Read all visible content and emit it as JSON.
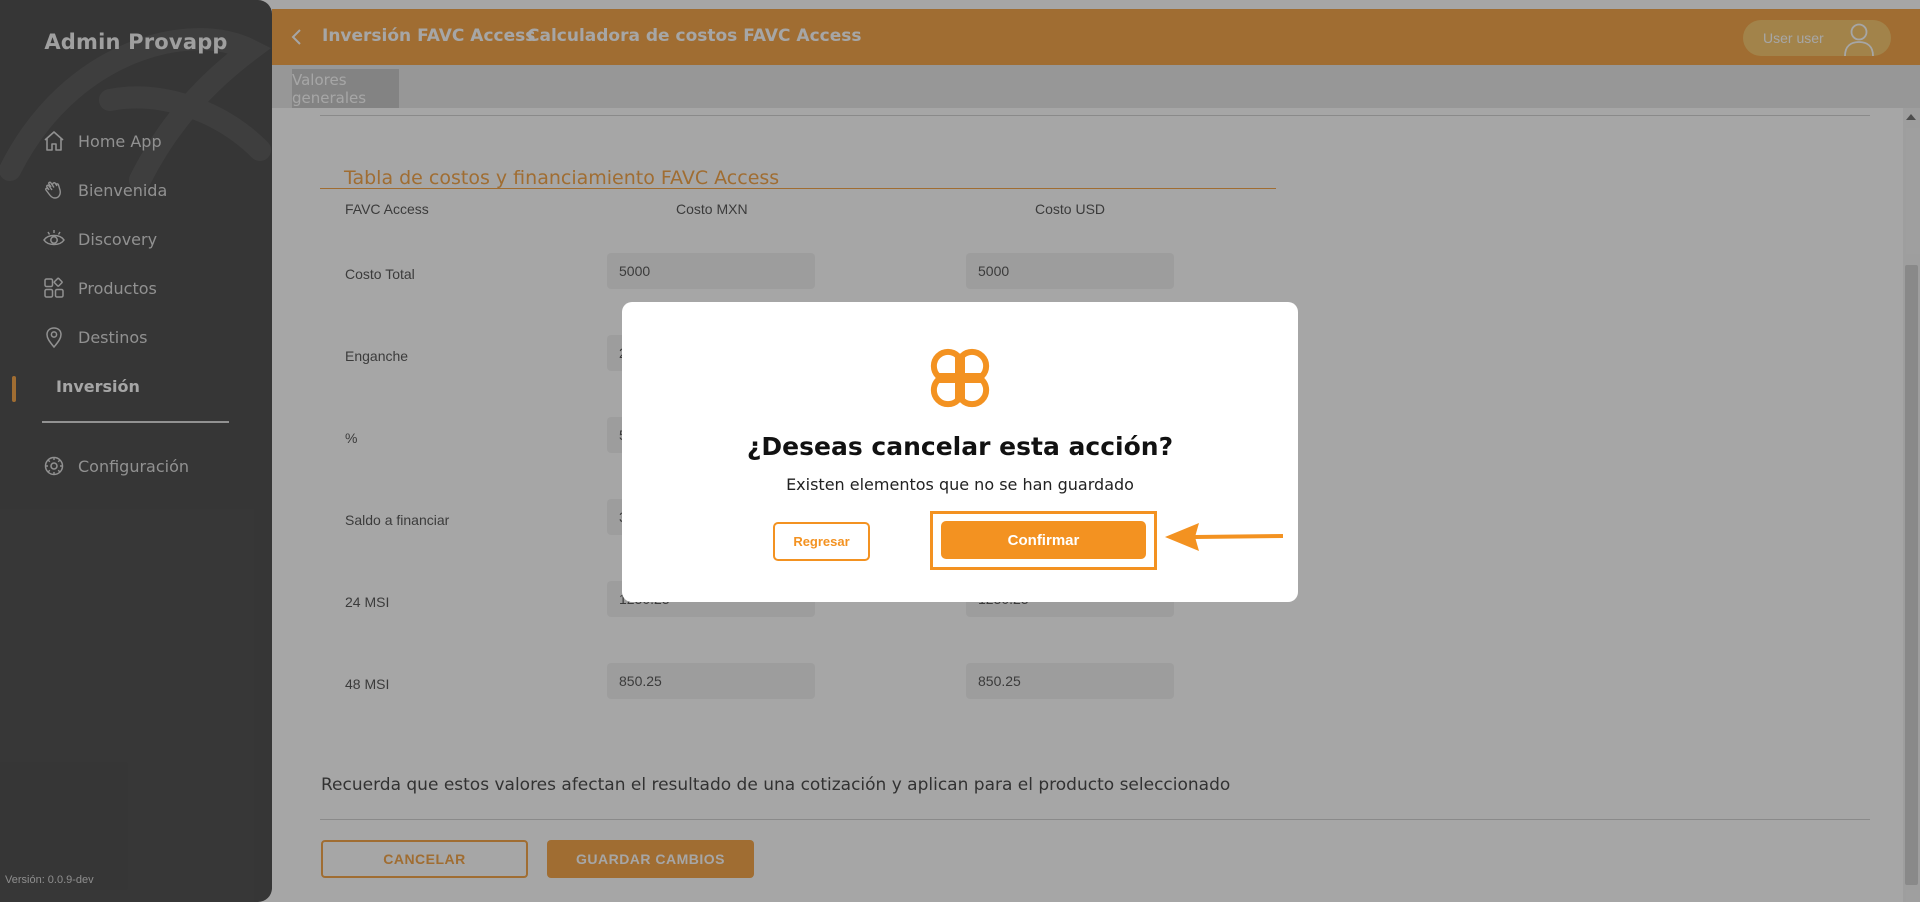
{
  "sidebar": {
    "brand": "Admin Provapp",
    "items": [
      {
        "label": "Home App",
        "icon": "home-icon"
      },
      {
        "label": "Bienvenida",
        "icon": "wave-hand-icon"
      },
      {
        "label": "Discovery",
        "icon": "eye-icon"
      },
      {
        "label": "Productos",
        "icon": "grid-icon"
      },
      {
        "label": "Destinos",
        "icon": "location-pin-icon"
      },
      {
        "label": "Inversión",
        "icon": "",
        "active": true
      },
      {
        "label": "Configuración",
        "icon": "gear-icon"
      }
    ],
    "version": "Versión: 0.0.9-dev"
  },
  "header": {
    "crumb1": "Inversión FAVC Access",
    "crumb2": "Calculadora de costos FAVC Access",
    "user": "User user"
  },
  "tabs": {
    "active": "Valores generales"
  },
  "table": {
    "title": "Tabla de costos y financiamiento FAVC Access",
    "columns": [
      "FAVC Access",
      "Costo MXN",
      "Costo USD"
    ],
    "rows": [
      {
        "label": "Costo Total",
        "mxn": "5000",
        "usd": "5000"
      },
      {
        "label": "Enganche",
        "mxn": "2",
        "usd": ""
      },
      {
        "label": "%",
        "mxn": "5",
        "usd": ""
      },
      {
        "label": "Saldo a financiar",
        "mxn": "3",
        "usd": ""
      },
      {
        "label": "24 MSI",
        "mxn": "1250.25",
        "usd": "1250.25"
      },
      {
        "label": "48 MSI",
        "mxn": "850.25",
        "usd": "850.25"
      }
    ]
  },
  "footer": {
    "note": "Recuerda que estos valores afectan el resultado de una cotización y aplican para el producto seleccionado",
    "cancel": "CANCELAR",
    "save": "GUARDAR CAMBIOS"
  },
  "modal": {
    "title": "¿Deseas cancelar esta acción?",
    "subtitle": "Existen elementos que no se han guardado",
    "back": "Regresar",
    "confirm": "Confirmar"
  },
  "colors": {
    "accent": "#f39221",
    "sidebar": "#2a2a2a",
    "overlay": "rgba(70,70,70,0.48)"
  }
}
